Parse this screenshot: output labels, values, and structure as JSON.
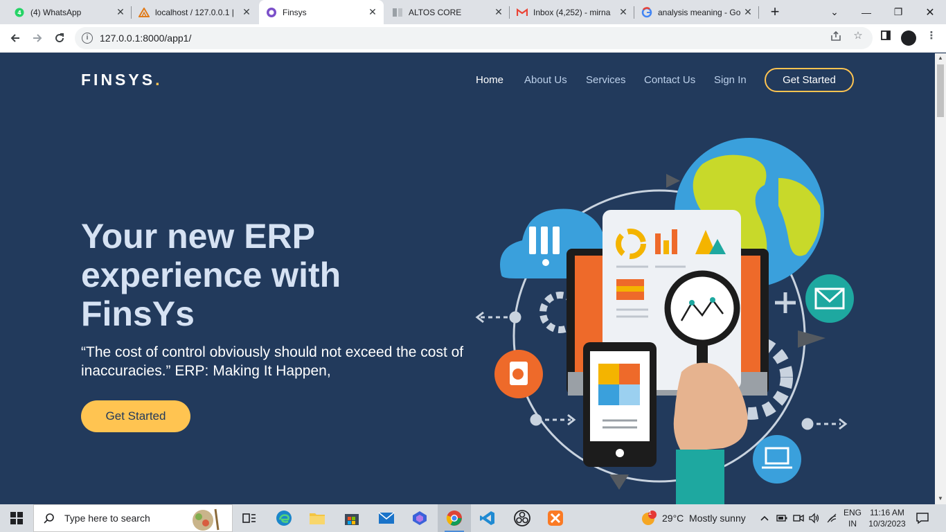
{
  "browser": {
    "tabs": [
      {
        "label": "(4) WhatsApp",
        "icon": "whatsapp-icon"
      },
      {
        "label": "localhost / 127.0.0.1 |",
        "icon": "phpmyadmin-icon"
      },
      {
        "label": "Finsys",
        "icon": "finsys-icon"
      },
      {
        "label": "ALTOS CORE",
        "icon": "page-icon"
      },
      {
        "label": "Inbox (4,252) - mirna",
        "icon": "gmail-icon"
      },
      {
        "label": "analysis meaning - Go",
        "icon": "google-icon"
      }
    ],
    "active_tab": 2,
    "url": "127.0.0.1:8000/app1/"
  },
  "site": {
    "logo": "FINSYS",
    "logo_dot": ".",
    "nav": [
      "Home",
      "About Us",
      "Services",
      "Contact Us",
      "Sign In"
    ],
    "nav_cta": "Get Started",
    "hero_title": "Your new ERP experience with FinsYs",
    "hero_subtitle": "“The cost of control obviously should not exceed the cost of inaccuracies.” ERP: Making It Happen,",
    "hero_button": "Get Started",
    "accent_color": "#ffc451",
    "background_color": "#223a5c"
  },
  "taskbar": {
    "search_placeholder": "Type here to search",
    "weather": "29°C  Mostly sunny",
    "weather_badge": "1",
    "lang_top": "ENG",
    "lang_bottom": "IN",
    "time": "11:16 AM",
    "date": "10/3/2023"
  }
}
